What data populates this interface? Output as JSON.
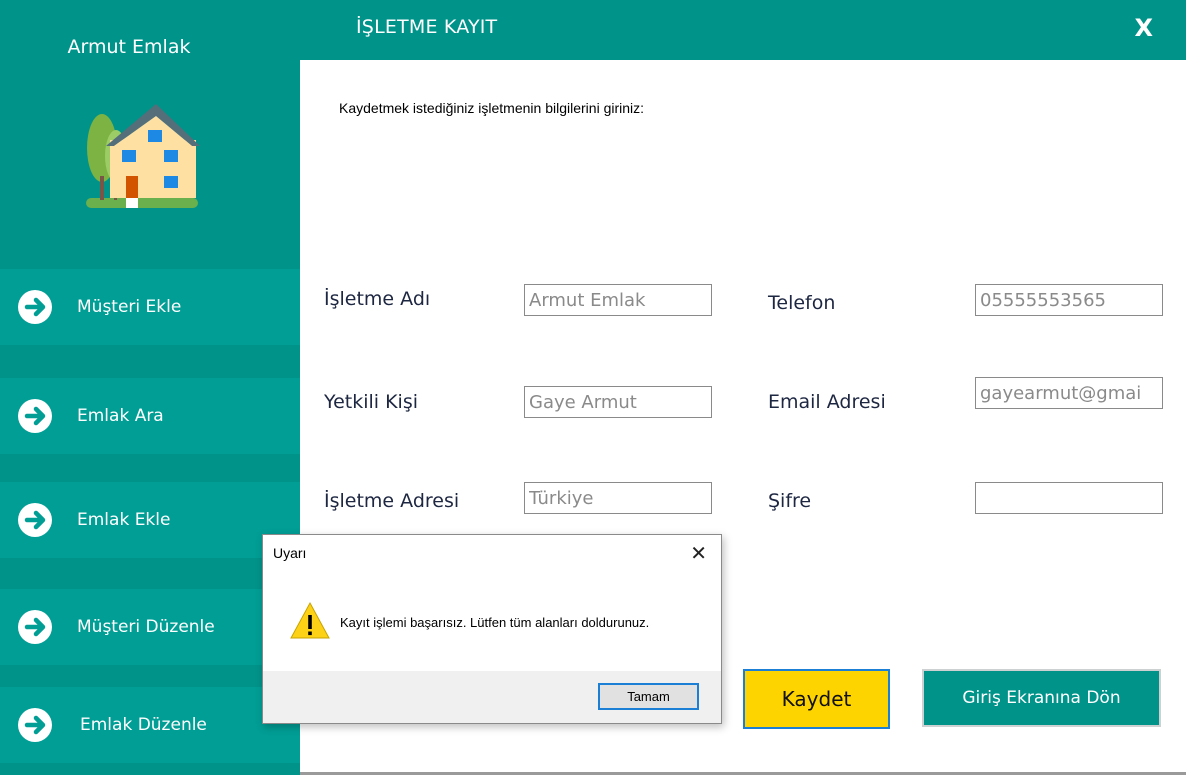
{
  "sidebar": {
    "brand": "Armut Emlak",
    "items": [
      {
        "label": "Müşteri Ekle",
        "icon": "arrow-right-circle-icon"
      },
      {
        "label": "Emlak Ara",
        "icon": "arrow-right-circle-icon"
      },
      {
        "label": "Emlak Ekle",
        "icon": "arrow-right-circle-icon"
      },
      {
        "label": "Müşteri Düzenle",
        "icon": "arrow-right-circle-icon"
      },
      {
        "label": "Emlak Düzenle",
        "icon": "arrow-right-circle-icon"
      }
    ]
  },
  "header": {
    "title": "İŞLETME KAYIT",
    "close_label": "X"
  },
  "form": {
    "instruction": "Kaydetmek istediğiniz işletmenin bilgilerini giriniz:",
    "business_name": {
      "label": "İşletme Adı",
      "value": "Armut Emlak"
    },
    "contact_person": {
      "label": "Yetkili Kişi",
      "value": "Gaye Armut"
    },
    "business_address": {
      "label": "İşletme Adresi",
      "value": "Türkiye"
    },
    "phone": {
      "label": "Telefon",
      "value": "05555553565"
    },
    "email": {
      "label": "Email Adresi",
      "value": "gayearmut@gmai"
    },
    "password": {
      "label": "Şifre",
      "value": ""
    },
    "save_label": "Kaydet",
    "back_label": "Giriş Ekranına Dön"
  },
  "dialog": {
    "title": "Uyarı",
    "close_label": "✕",
    "message": "Kayıt işlemi başarısız. Lütfen tüm alanları doldurunuz.",
    "ok_label": "Tamam",
    "icon": "warning-icon"
  },
  "colors": {
    "teal": "#00938a",
    "teal_light": "#009e95",
    "yellow": "#fdd400",
    "focus_blue": "#1b7fd6"
  }
}
